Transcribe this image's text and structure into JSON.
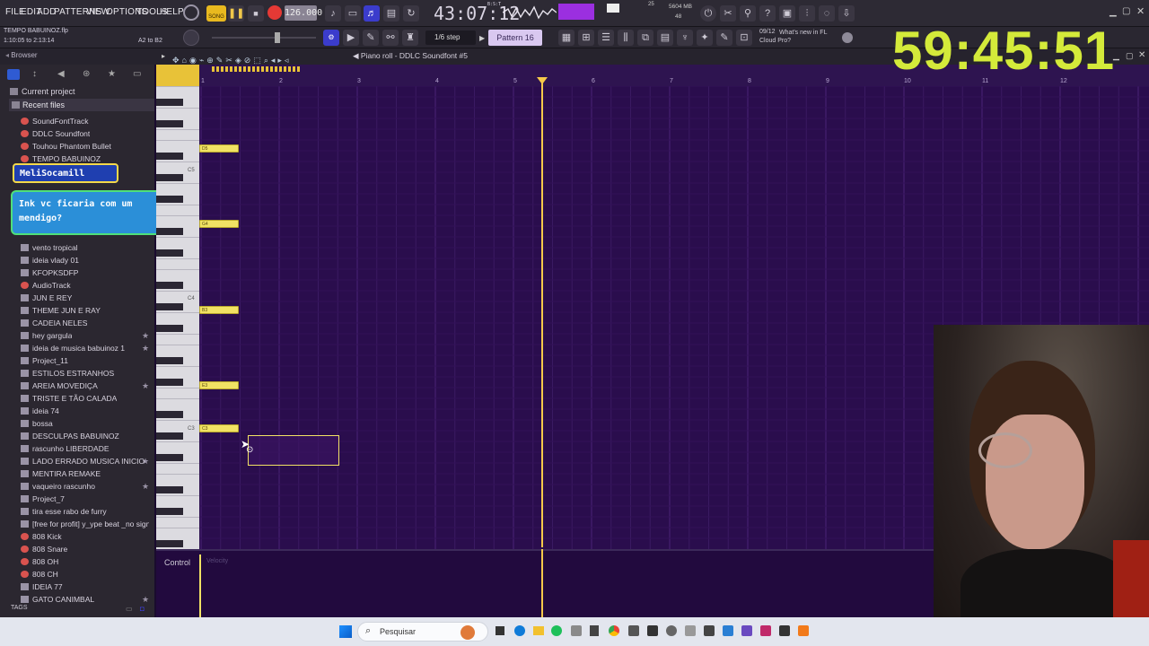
{
  "menu": [
    "FILE",
    "EDIT",
    "ADD",
    "PATTERNS",
    "VIEW",
    "OPTIONS",
    "TOOLS",
    "HELP"
  ],
  "transport": {
    "song_label": "SONG",
    "tempo": "126.000",
    "time": "43:07:12",
    "time_small": "B:S:T"
  },
  "perf": {
    "voices": "25",
    "ram": "5604 MB",
    "cpu": "48"
  },
  "project": {
    "filename": "TEMPO BABUINOZ.flp",
    "range": "1:10:05 to 2:13:14",
    "keys": "A2 to B2"
  },
  "snap": "1/6 step",
  "pattern": "Pattern 16",
  "news": {
    "date": "09/12",
    "text": "What's new in FL Cloud Pro?"
  },
  "timer": "59:45:51",
  "window_title": "Piano roll - DDLC Soundfont #5",
  "browser": {
    "title": "Browser",
    "current_project": "Current project",
    "recent_files": "Recent files",
    "items": [
      {
        "label": "SoundFontTrack",
        "icon": "track-icon",
        "fav": false
      },
      {
        "label": "DDLC Soundfont",
        "icon": "track-icon",
        "fav": false
      },
      {
        "label": "Touhou Phantom Bullet",
        "icon": "track-icon",
        "fav": false
      },
      {
        "label": "TEMPO BABUINOZ",
        "icon": "track-icon",
        "fav": false
      },
      {
        "label": "vento tropical",
        "icon": "file-icon",
        "fav": false
      },
      {
        "label": "ideia vlady 01",
        "icon": "file-icon",
        "fav": false
      },
      {
        "label": "KFOPKSDFP",
        "icon": "file-icon",
        "fav": false
      },
      {
        "label": "AudioTrack",
        "icon": "track-icon",
        "fav": false
      },
      {
        "label": "JUN E REY",
        "icon": "file-icon",
        "fav": false
      },
      {
        "label": "THEME JUN E RAY",
        "icon": "file-icon",
        "fav": false
      },
      {
        "label": "CADEIA NELES",
        "icon": "file-icon",
        "fav": false
      },
      {
        "label": "hey gargula",
        "icon": "file-icon",
        "fav": true
      },
      {
        "label": "ideia de musica babuinoz 1",
        "icon": "file-icon",
        "fav": true
      },
      {
        "label": "Project_11",
        "icon": "file-icon",
        "fav": false
      },
      {
        "label": "ESTILOS ESTRANHOS",
        "icon": "file-icon",
        "fav": false
      },
      {
        "label": "AREIA MOVEDIÇA",
        "icon": "file-icon",
        "fav": true
      },
      {
        "label": "TRISTE E TÃO CALADA",
        "icon": "file-icon",
        "fav": false
      },
      {
        "label": "ideia 74",
        "icon": "file-icon",
        "fav": false
      },
      {
        "label": "bossa",
        "icon": "file-icon",
        "fav": false
      },
      {
        "label": "DESCULPAS BABUINOZ",
        "icon": "file-icon",
        "fav": false
      },
      {
        "label": "rascunho LIBERDADE",
        "icon": "file-icon",
        "fav": false
      },
      {
        "label": "LADO ERRADO MUSICA INICIO",
        "icon": "file-icon",
        "fav": true
      },
      {
        "label": "MENTIRA REMAKE",
        "icon": "file-icon",
        "fav": false
      },
      {
        "label": "vaqueiro rascunho",
        "icon": "file-icon",
        "fav": true
      },
      {
        "label": "Project_7",
        "icon": "file-icon",
        "fav": false
      },
      {
        "label": "tira esse rabo de furry",
        "icon": "file-icon",
        "fav": false
      },
      {
        "label": "[free for profit] y_ype beat _no signal_",
        "icon": "file-icon",
        "fav": false
      },
      {
        "label": "808 Kick",
        "icon": "track-icon",
        "fav": false
      },
      {
        "label": "808 Snare",
        "icon": "track-icon",
        "fav": false
      },
      {
        "label": "808 OH",
        "icon": "track-icon",
        "fav": false
      },
      {
        "label": "808 CH",
        "icon": "track-icon",
        "fav": false
      },
      {
        "label": "IDEIA 77",
        "icon": "file-icon",
        "fav": false
      },
      {
        "label": "GATO CANIMBAL",
        "icon": "file-icon",
        "fav": true
      }
    ],
    "tags": "TAGS"
  },
  "chat": {
    "user": "MeliSocamill",
    "message": "Ink vc ficaria com um mendigo?"
  },
  "ruler": [
    "1",
    "2",
    "3",
    "4",
    "5",
    "6",
    "7",
    "8",
    "9",
    "10",
    "11",
    "12"
  ],
  "octaves": [
    "C5",
    "C4",
    "C3"
  ],
  "notes": [
    "D5",
    "G4",
    "B3",
    "E3",
    "C3"
  ],
  "control": {
    "label": "Control",
    "param": "Velocity"
  },
  "taskbar": {
    "search": "Pesquisar"
  },
  "colors": {
    "note": "#f1e264",
    "roll_bg": "#2a0d4d",
    "playhead": "#f6c94a",
    "timer": "#d4ea3a"
  }
}
